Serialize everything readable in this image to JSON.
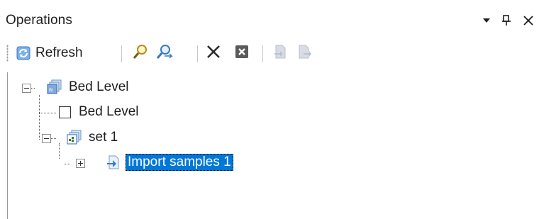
{
  "panel": {
    "title": "Operations",
    "controls": {
      "dropdown_icon": "chevron-down-icon",
      "pin_icon": "pin-icon",
      "close_icon": "close-icon"
    }
  },
  "toolbar": {
    "refresh_label": "Refresh",
    "refresh_icon": "refresh-icon",
    "buttons": [
      {
        "icon": "find-icon"
      },
      {
        "icon": "find-next-icon"
      },
      {
        "icon": "delete-icon"
      },
      {
        "icon": "delete-all-icon"
      },
      {
        "icon": "import-disabled-icon"
      },
      {
        "icon": "export-disabled-icon"
      }
    ]
  },
  "tree": {
    "nodes": [
      {
        "label": "Bed Level",
        "icon": "dataset-icon",
        "expanded": true
      },
      {
        "label": "Bed Level",
        "icon": "checkbox-icon",
        "checked": false
      },
      {
        "label": "set 1",
        "icon": "set-icon",
        "expanded": true
      },
      {
        "label": "Import samples 1",
        "icon": "import-icon",
        "expanded": false,
        "selected": true
      }
    ]
  },
  "colors": {
    "selection": "#0078d7",
    "selection_text": "#ffffff",
    "text": "#1e1e1e"
  }
}
